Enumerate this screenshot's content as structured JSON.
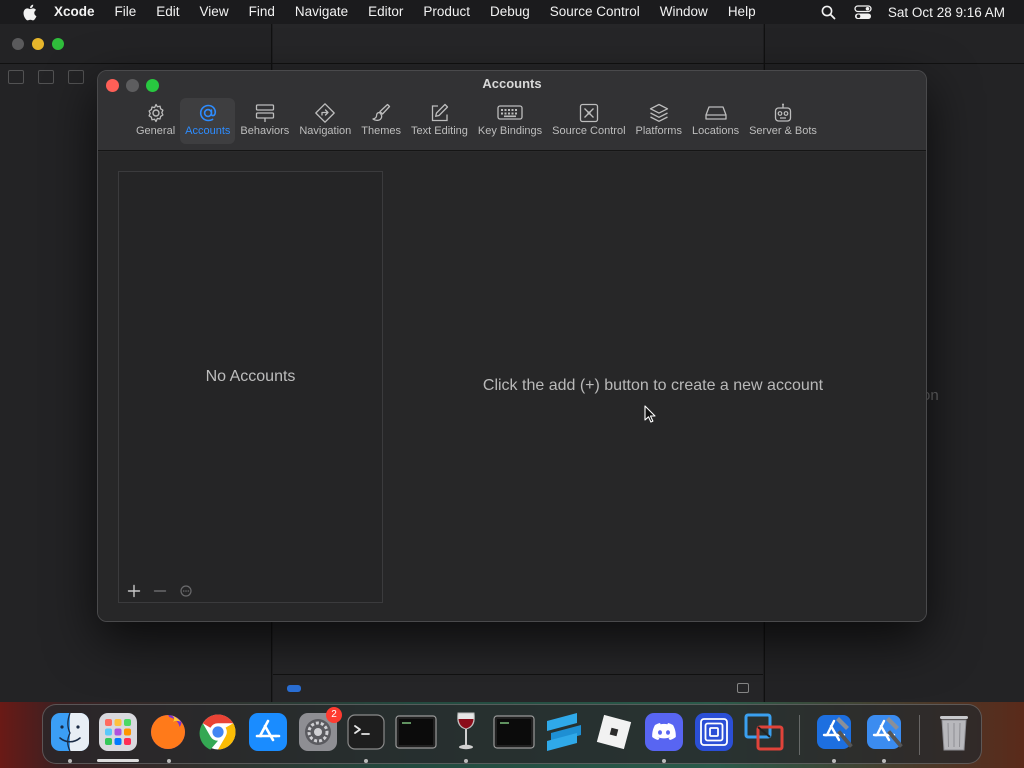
{
  "menubar": {
    "app_name": "Xcode",
    "items": [
      "File",
      "Edit",
      "View",
      "Find",
      "Navigate",
      "Editor",
      "Product",
      "Debug",
      "Source Control",
      "Window",
      "Help"
    ],
    "clock": "Sat Oct 28  9:16 AM",
    "status_icons": [
      "search-icon",
      "control-center-icon"
    ]
  },
  "background_window": {
    "fragment": "on"
  },
  "prefs": {
    "title": "Accounts",
    "tabs": [
      {
        "label": "General",
        "icon": "gear-icon"
      },
      {
        "label": "Accounts",
        "icon": "at-sign-icon",
        "active": true
      },
      {
        "label": "Behaviors",
        "icon": "behaviors-icon"
      },
      {
        "label": "Navigation",
        "icon": "navigation-icon"
      },
      {
        "label": "Themes",
        "icon": "brush-icon"
      },
      {
        "label": "Text Editing",
        "icon": "pencil-square-icon"
      },
      {
        "label": "Key Bindings",
        "icon": "keyboard-icon"
      },
      {
        "label": "Source Control",
        "icon": "source-control-icon"
      },
      {
        "label": "Platforms",
        "icon": "layers-icon"
      },
      {
        "label": "Locations",
        "icon": "drive-icon"
      },
      {
        "label": "Server & Bots",
        "icon": "robot-icon"
      }
    ],
    "empty_list_label": "No Accounts",
    "empty_detail_label": "Click the add (+) button to create a new account"
  },
  "dock": {
    "items": [
      {
        "name": "Finder",
        "icon": "finder-icon",
        "running": true
      },
      {
        "name": "Launchpad",
        "icon": "launchpad-icon",
        "running": true
      },
      {
        "name": "Firefox",
        "icon": "firefox-icon",
        "running": true
      },
      {
        "name": "Chrome",
        "icon": "chrome-icon",
        "running": false
      },
      {
        "name": "App Store",
        "icon": "app-store-icon",
        "running": false
      },
      {
        "name": "System Settings",
        "icon": "settings-icon",
        "running": false,
        "badge": "2"
      },
      {
        "name": "Terminal",
        "icon": "terminal-icon",
        "running": true
      },
      {
        "name": "Console",
        "icon": "console-icon",
        "running": false
      },
      {
        "name": "Wine",
        "icon": "wine-icon",
        "running": true
      },
      {
        "name": "Console 2",
        "icon": "console-icon",
        "running": false
      },
      {
        "name": "Sublime",
        "icon": "sublime-icon",
        "running": false
      },
      {
        "name": "Roblox",
        "icon": "roblox-icon",
        "running": false
      },
      {
        "name": "Discord",
        "icon": "discord-icon",
        "running": true
      },
      {
        "name": "Tunnel",
        "icon": "tunnel-icon",
        "running": false
      },
      {
        "name": "Parallels",
        "icon": "parallels-icon",
        "running": false
      },
      {
        "name": "Xcode",
        "icon": "xcode-icon",
        "running": true
      },
      {
        "name": "Xcode Beta",
        "icon": "xcode-icon",
        "running": true
      },
      {
        "name": "Trash",
        "icon": "trash-icon",
        "running": false
      }
    ],
    "badge_value": "2"
  }
}
